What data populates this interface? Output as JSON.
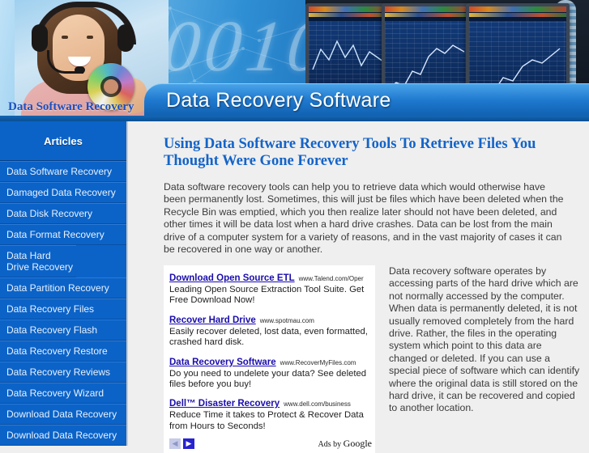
{
  "banner": {
    "logo_text": "Data Software Recovery",
    "title": "Data Recovery Software",
    "binary_digits": "10010"
  },
  "sidebar": {
    "heading": "Articles",
    "items": [
      {
        "label": "Data Software Recovery"
      },
      {
        "label": "Damaged Data Recovery"
      },
      {
        "label": "Data Disk Recovery"
      },
      {
        "label": "Data Format Recovery"
      },
      {
        "label": "Data Hard Drive Recovery"
      },
      {
        "label": "Data Partition Recovery"
      },
      {
        "label": "Data Recovery Files"
      },
      {
        "label": "Data Recovery Flash"
      },
      {
        "label": "Data Recovery Restore"
      },
      {
        "label": "Data Recovery Reviews"
      },
      {
        "label": "Data Recovery Wizard"
      },
      {
        "label": "Download Data Recovery"
      },
      {
        "label": "Download Data Recovery"
      }
    ],
    "accent_color": "#0b63c8"
  },
  "article": {
    "title": "Using Data Software Recovery Tools To Retrieve Files You Thought Were Gone Forever",
    "title_color": "#1464c8",
    "intro": "Data software recovery tools can help you to retrieve data which would otherwise have been permanently lost. Sometimes, this will just be files which have been deleted when the Recycle Bin was emptied, which you then realize later should not have been deleted, and other times it will be data lost when a hard drive crashes. Data can be lost from the main drive of a computer system for a variety of reasons, and in the vast majority of cases it can be recovered in one way or another.",
    "right_column": "Data recovery software operates by accessing parts of the hard drive which are not normally accessed by the computer. When data is permanently deleted, it is not usually removed completely from the hard drive. Rather, the files in the operating system which point to this data are changed or deleted. If you can use a special piece of software which can identify where the original data is still stored on the hard drive, it can be recovered and copied to another location."
  },
  "ads": {
    "items": [
      {
        "title": "Download Open Source ETL",
        "url": "www.Talend.com/Oper",
        "desc": "Leading Open Source Extraction Tool Suite. Get Free Download Now!"
      },
      {
        "title": "Recover Hard Drive",
        "url": "www.spotmau.com",
        "desc": "Easily recover deleted, lost data, even formatted, crashed hard disk."
      },
      {
        "title": "Data Recovery Software",
        "url": "www.RecoverMyFiles.com",
        "desc": "Do you need to undelete your data? See deleted files before you buy!"
      },
      {
        "title": "Dell™ Disaster Recovery",
        "url": "www.dell.com/business",
        "desc": "Reduce Time it takes to Protect & Recover Data from Hours to Seconds!"
      }
    ],
    "prev_label": "◀",
    "next_label": "▶",
    "attribution_prefix": "Ads by ",
    "attribution_brand": "Google",
    "link_color": "#1a0dab"
  }
}
